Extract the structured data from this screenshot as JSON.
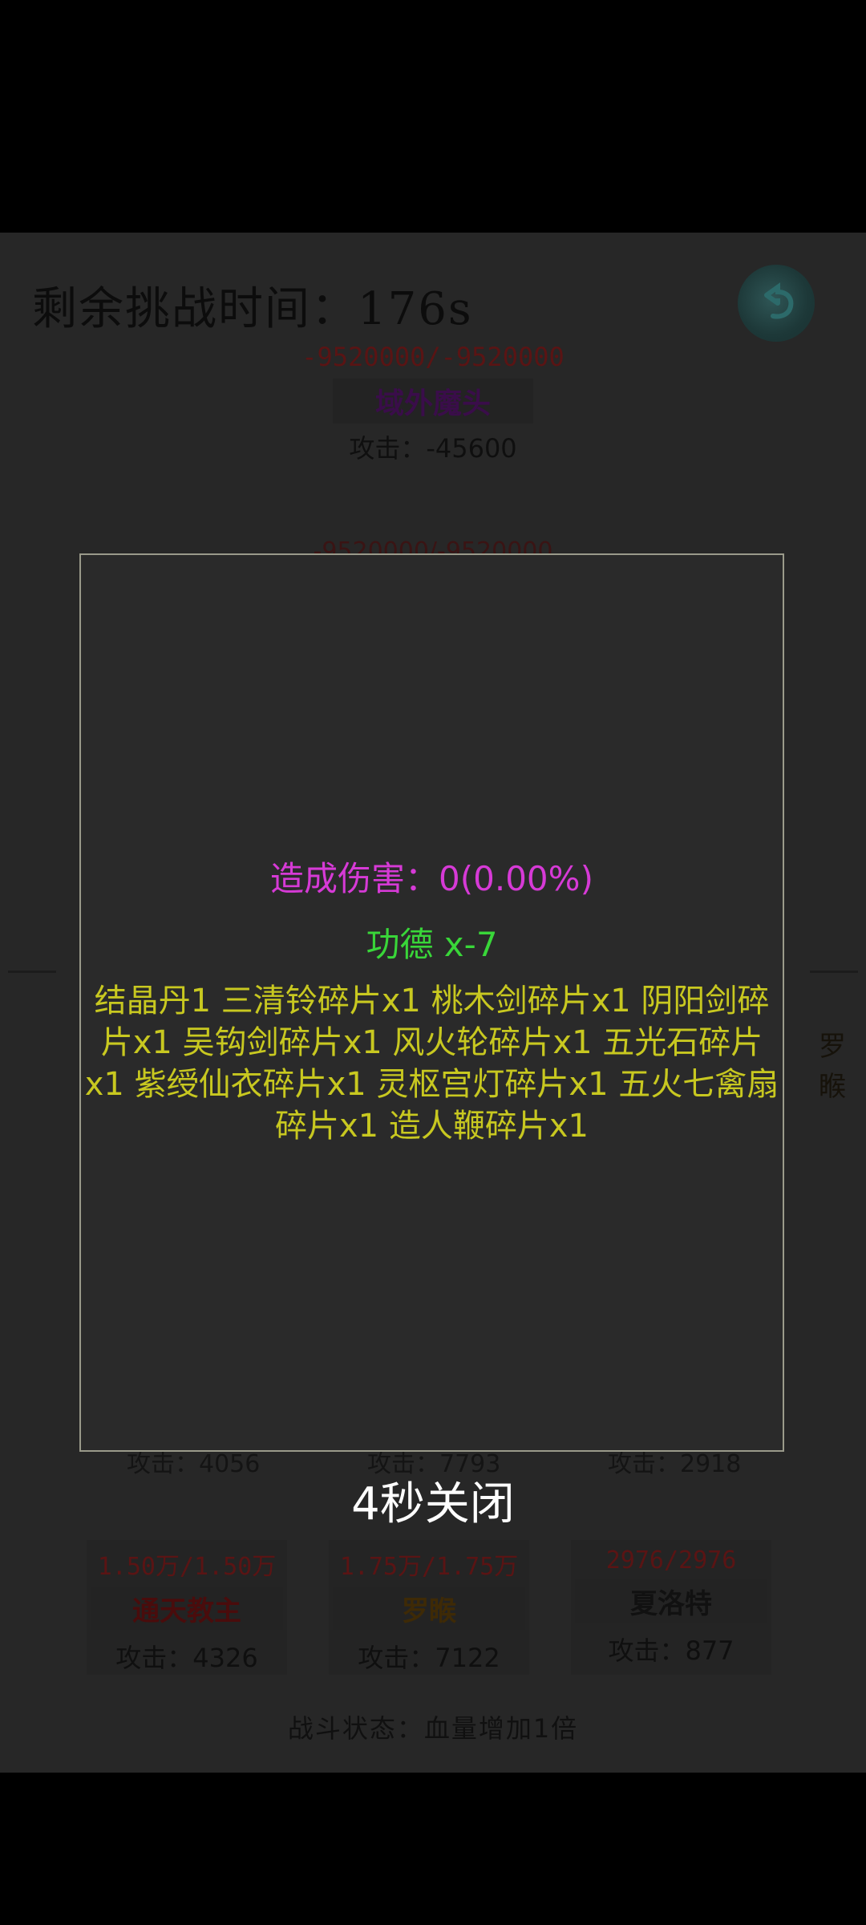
{
  "timer": "剩余挑战时间：176s",
  "boss": {
    "hp": "-9520000/-9520000",
    "name": "域外魔头",
    "attack": "攻击：-45600",
    "name_color": "#3a0d4a"
  },
  "ghost_hp": "-9520000/-9520000",
  "side_name": "罗睺",
  "ghost_attacks": [
    "攻击：4056",
    "攻击：7793",
    "攻击：2918"
  ],
  "cards": [
    {
      "hp": "1.50万/1.50万",
      "name": "通天教主",
      "attack": "攻击：4326",
      "name_color": "#4a0c0c"
    },
    {
      "hp": "1.75万/1.75万",
      "name": "罗睺",
      "attack": "攻击：7122",
      "name_color": "#3e2a06"
    },
    {
      "hp": "2976/2976",
      "name": "夏洛特",
      "attack": "攻击：877",
      "name_color": "#111111"
    }
  ],
  "status": "战斗状态：血量增加1倍",
  "dialog": {
    "damage": "造成伤害：0(0.00%)",
    "merit": "功德 x-7",
    "rewards": "结晶丹1  三清铃碎片x1  桃木剑碎片x1  阴阳剑碎片x1  吴钩剑碎片x1  风火轮碎片x1  五光石碎片x1  紫绶仙衣碎片x1  灵枢宫灯碎片x1  五火七禽扇碎片x1  造人鞭碎片x1",
    "close": "4秒关闭",
    "colors": {
      "damage": "#d63ad6",
      "merit": "#39d639",
      "rewards": "#c8c820"
    }
  },
  "icons": {
    "back": "return-arrow-icon"
  }
}
